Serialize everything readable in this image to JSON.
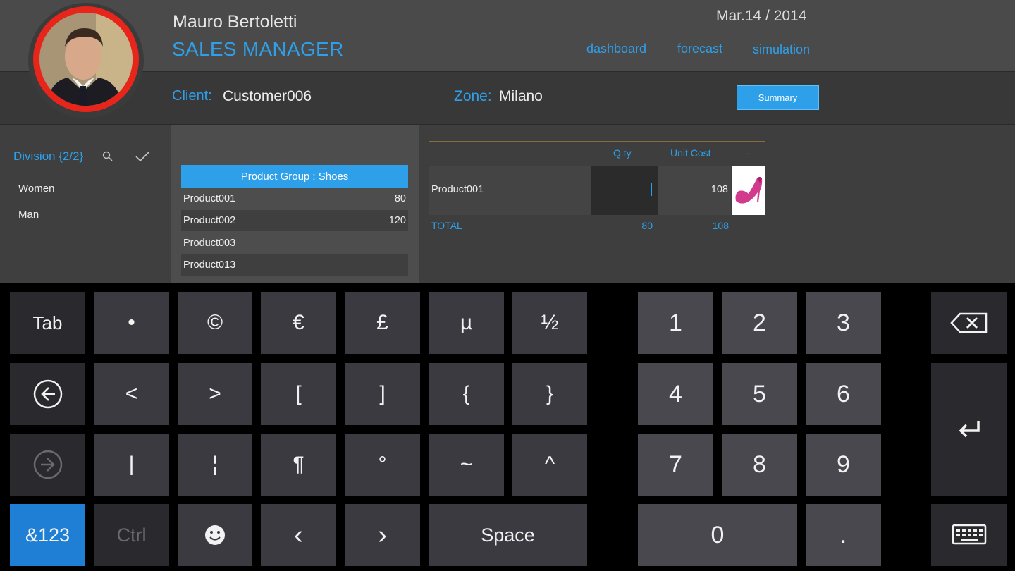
{
  "header": {
    "user_name": "Mauro Bertoletti",
    "role": "SALES MANAGER",
    "date": "Mar.14 / 2014",
    "nav": [
      "dashboard",
      "forecast",
      "simulation"
    ]
  },
  "client_bar": {
    "client_label": "Client:",
    "client_value": "Customer006",
    "zone_label": "Zone:",
    "zone_value": "Milano",
    "summary_button": "Summary"
  },
  "division": {
    "title": "Division {2/2}",
    "items": [
      "Women",
      "Man"
    ]
  },
  "product_group": {
    "header": "Product Group : Shoes",
    "rows": [
      {
        "name": "Product001",
        "value": "80"
      },
      {
        "name": "Product002",
        "value": "120"
      },
      {
        "name": "Product003",
        "value": ""
      },
      {
        "name": "Product013",
        "value": ""
      }
    ]
  },
  "order": {
    "columns": [
      "Q.ty",
      "Unit Cost",
      "-"
    ],
    "row": {
      "product": "Product001",
      "qty": "",
      "unit_cost": "108"
    },
    "total": {
      "label": "TOTAL",
      "qty": "80",
      "unit_cost": "108"
    }
  },
  "keyboard": {
    "row1": [
      "Tab",
      "•",
      "©",
      "€",
      "£",
      "µ",
      "½"
    ],
    "row2": [
      "<",
      ">",
      "[",
      "]",
      "{",
      "}"
    ],
    "row3": [
      "|",
      "¦",
      "¶",
      "°",
      "~",
      "^"
    ],
    "row4": [
      "&123",
      "Ctrl",
      "‹",
      "›",
      "Space"
    ],
    "numpad": [
      "1",
      "2",
      "3",
      "4",
      "5",
      "6",
      "7",
      "8",
      "9",
      "0",
      "."
    ],
    "colors": {
      "accent": "#1e7fd4",
      "key": "#3b3a40",
      "numkey": "#49484e"
    }
  },
  "colors": {
    "accent": "#2ea0ea",
    "avatar_ring": "#e8251a",
    "header_bg": "#4a4a4b"
  }
}
